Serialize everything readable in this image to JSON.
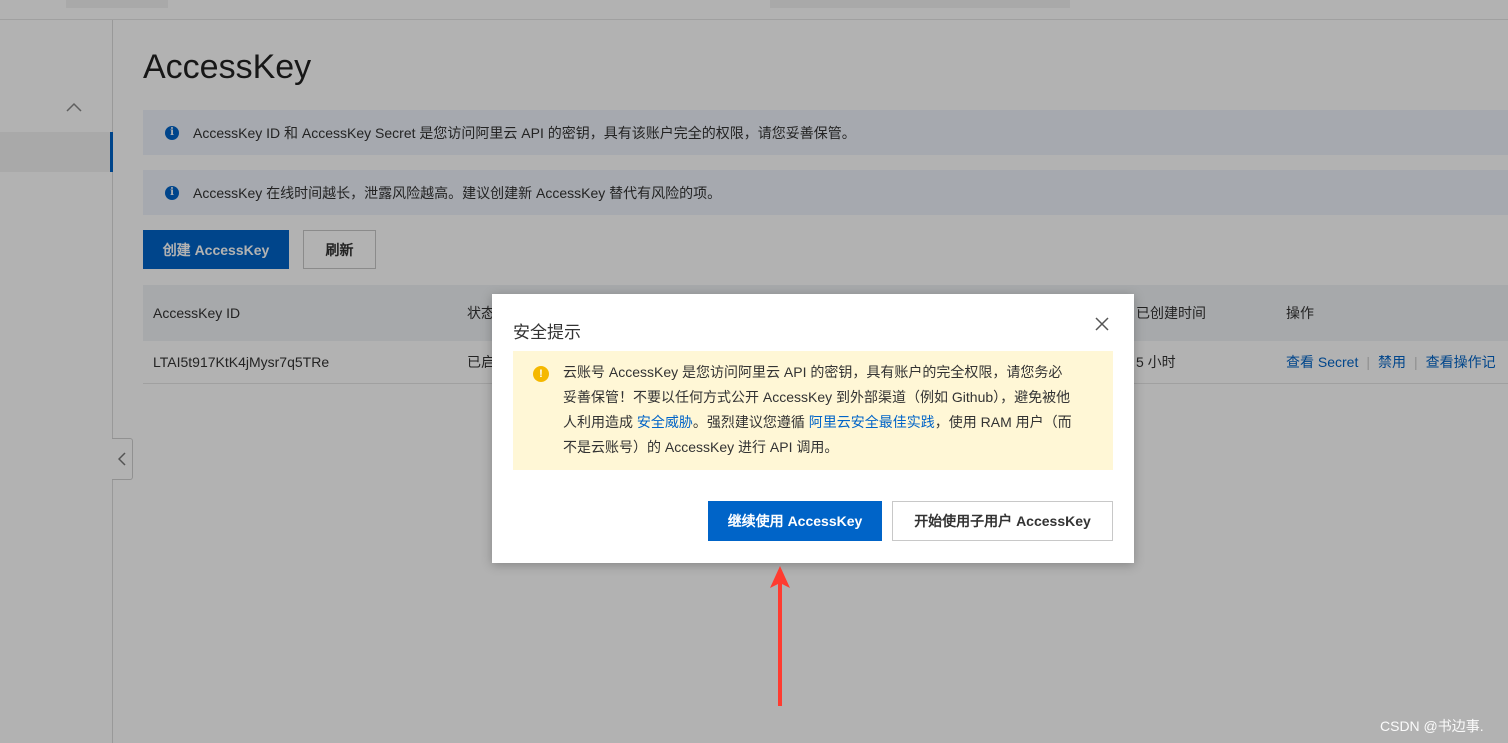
{
  "page": {
    "title": "AccessKey"
  },
  "notices": [
    {
      "text": "AccessKey ID 和 AccessKey Secret 是您访问阿里云 API 的密钥，具有该账户完全的权限，请您妥善保管。"
    },
    {
      "text": "AccessKey 在线时间越长，泄露风险越高。建议创建新 AccessKey 替代有风险的项。"
    }
  ],
  "toolbar": {
    "create_label": "创建 AccessKey",
    "refresh_label": "刷新"
  },
  "table": {
    "headers": {
      "id": "AccessKey ID",
      "status": "状态",
      "created": "已创建时间",
      "actions": "操作"
    },
    "row": {
      "id": "LTAI5t917KtK4jMysr7q5TRe",
      "status": "已启",
      "created": "5 小时",
      "action_secret": "查看 Secret",
      "action_disable": "禁用",
      "action_log": "查看操作记"
    }
  },
  "modal": {
    "title": "安全提示",
    "warning_part1": "云账号 AccessKey 是您访问阿里云 API 的密钥，具有账户的完全权限，请您务必妥善保管！不要以任何方式公开 AccessKey 到外部渠道（例如 Github），避免被他人利用造成 ",
    "warning_link1": "安全威胁",
    "warning_part2": "。强烈建议您遵循 ",
    "warning_link2": "阿里云安全最佳实践",
    "warning_part3": "，使用 RAM 用户（而不是云账号）的 AccessKey 进行 API 调用。",
    "continue_label": "继续使用 AccessKey",
    "subuser_label": "开始使用子用户 AccessKey"
  },
  "watermark": "CSDN @书边事.",
  "colors": {
    "primary": "#0064c8",
    "warning_bg": "#fff7d6",
    "warning_icon": "#f5b800",
    "annotation_arrow": "#ff3b30"
  }
}
